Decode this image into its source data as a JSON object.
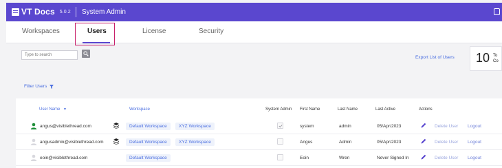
{
  "header": {
    "brand": "VT Docs",
    "version": "5.0.2",
    "section": "System Admin"
  },
  "tabs": [
    {
      "label": "Workspaces",
      "active": false
    },
    {
      "label": "Users",
      "active": true
    },
    {
      "label": "License",
      "active": false
    },
    {
      "label": "Security",
      "active": false
    }
  ],
  "toolbar": {
    "search_placeholder": "Type to search",
    "export_label": "Export List of Users",
    "stat_number": "10",
    "stat_label": "To\nCo",
    "filter_label": "Filter Users"
  },
  "table": {
    "columns": {
      "user_name": "User Name",
      "workspace": "Workspace",
      "system_admin": "System Admin",
      "first_name": "First Name",
      "last_name": "Last Name",
      "last_active": "Last Active",
      "actions": "Actions"
    },
    "rows": [
      {
        "email": "angus@visiblethread.com",
        "workspaces": [
          "Default Workspace",
          "XYZ Workspace"
        ],
        "system_admin": true,
        "first_name": "system",
        "last_name": "admin",
        "last_active": "05/Apr/2023",
        "delete_label": "Delete User",
        "logout_label": "Logout"
      },
      {
        "email": "angusadmin@visiblethread.com",
        "workspaces": [
          "Default Workspace",
          "XYZ Workspace"
        ],
        "system_admin": false,
        "first_name": "Angus",
        "last_name": "Admin",
        "last_active": "05/Apr/2023",
        "delete_label": "Delete User",
        "logout_label": "Logout"
      },
      {
        "email": "eoin@visiblethread.com",
        "workspaces": [
          "Default Workspace"
        ],
        "system_admin": false,
        "first_name": "Eoin",
        "last_name": "Wren",
        "last_active": "Never Signed In",
        "delete_label": "Delete User",
        "logout_label": "Logout"
      }
    ]
  },
  "colors": {
    "brand": "#5a47cf",
    "highlight": "#c8206a",
    "link": "#4a6ee0"
  }
}
